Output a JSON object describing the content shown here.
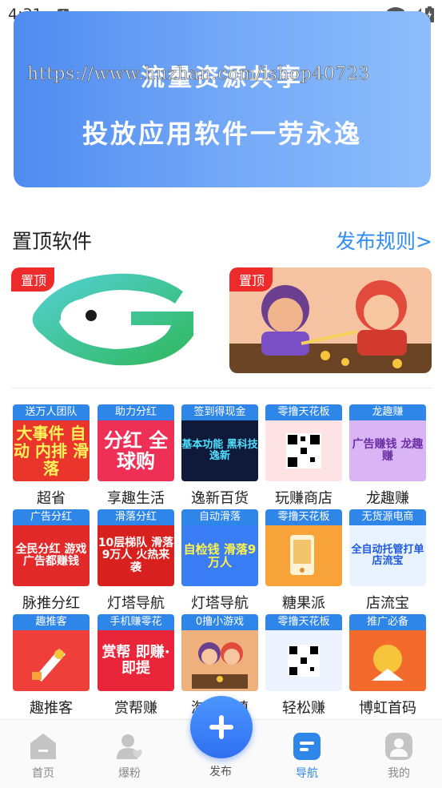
{
  "status_bar": {
    "time": "4:31",
    "notification_letter": "A"
  },
  "banner": {
    "line1": "流量资源共享",
    "line2": "投放应用软件一劳永逸",
    "watermark": "https://www.huzhan.com/ishop40723"
  },
  "section": {
    "title": "置顶软件",
    "link": "发布规则>"
  },
  "pinned": [
    {
      "tag": "置顶"
    },
    {
      "tag": "置顶"
    }
  ],
  "grid_items": [
    {
      "tag": "送万人团队",
      "body": "大事件 自动 内排 滑落",
      "name": "超省",
      "bg": "#e9352c",
      "fg": "#fff35a"
    },
    {
      "tag": "助力分红",
      "body": "分红 全球购",
      "name": "享趣生活",
      "bg": "#ee2f56",
      "fg": "#ffffff"
    },
    {
      "tag": "签到得现金",
      "body": "基本功能 黑科技 逸新",
      "name": "逸新百货",
      "bg": "#0f1a3a",
      "fg": "#4fe0ff"
    },
    {
      "tag": "零撸天花板",
      "body": "",
      "name": "玩赚商店",
      "bg": "#fde3e3",
      "fg": "#e23b3b"
    },
    {
      "tag": "龙趣赚",
      "body": "广告赚钱 龙趣赚",
      "name": "龙趣赚",
      "bg": "#d9b5f5",
      "fg": "#6b2fa3"
    },
    {
      "tag": "广告分红",
      "body": "全民分红 游戏广告都赚钱",
      "name": "脉推分红",
      "bg": "#e22a2a",
      "fg": "#ffffff"
    },
    {
      "tag": "滑落分红",
      "body": "10层梯队 滑落9万人 火热来袭",
      "name": "灯塔导航",
      "bg": "#d8201e",
      "fg": "#ffffff"
    },
    {
      "tag": "自动滑落",
      "body": "自检钱 滑落9万人",
      "name": "灯塔导航",
      "bg": "#3b7df5",
      "fg": "#fff34a"
    },
    {
      "tag": "零撸天花板",
      "body": "",
      "name": "糖果派",
      "bg": "#f7a33a",
      "fg": "#ffffff"
    },
    {
      "tag": "无货源电商",
      "body": "全自动托管打单 店流宝",
      "name": "店流宝",
      "bg": "#e9f2ff",
      "fg": "#1e5be0"
    },
    {
      "tag": "趣推客",
      "body": "",
      "name": "趣推客",
      "bg": "#ee3f3a",
      "fg": "#ffffff"
    },
    {
      "tag": "手机赚零花",
      "body": "赏帮 即赚·即提",
      "name": "赏帮赚",
      "bg": "#e9253a",
      "fg": "#ffffff"
    },
    {
      "tag": "0撸小游戏",
      "body": "",
      "name": "淘金小镇",
      "bg": "#f0b07c",
      "fg": "#ffffff"
    },
    {
      "tag": "零撸天花板",
      "body": "",
      "name": "轻松赚",
      "bg": "#eef4ff",
      "fg": "#2f6ff0"
    },
    {
      "tag": "推广必备",
      "body": "",
      "name": "博虹首码",
      "bg": "#f26a2c",
      "fg": "#ffffff"
    }
  ],
  "tabs": [
    {
      "label": "首页"
    },
    {
      "label": "爆粉"
    },
    {
      "label": "发布"
    },
    {
      "label": "导航"
    },
    {
      "label": "我的"
    }
  ],
  "colors": {
    "accent": "#2f86e9",
    "pin_red": "#ee2b2b",
    "link_blue": "#2f8ef2"
  }
}
